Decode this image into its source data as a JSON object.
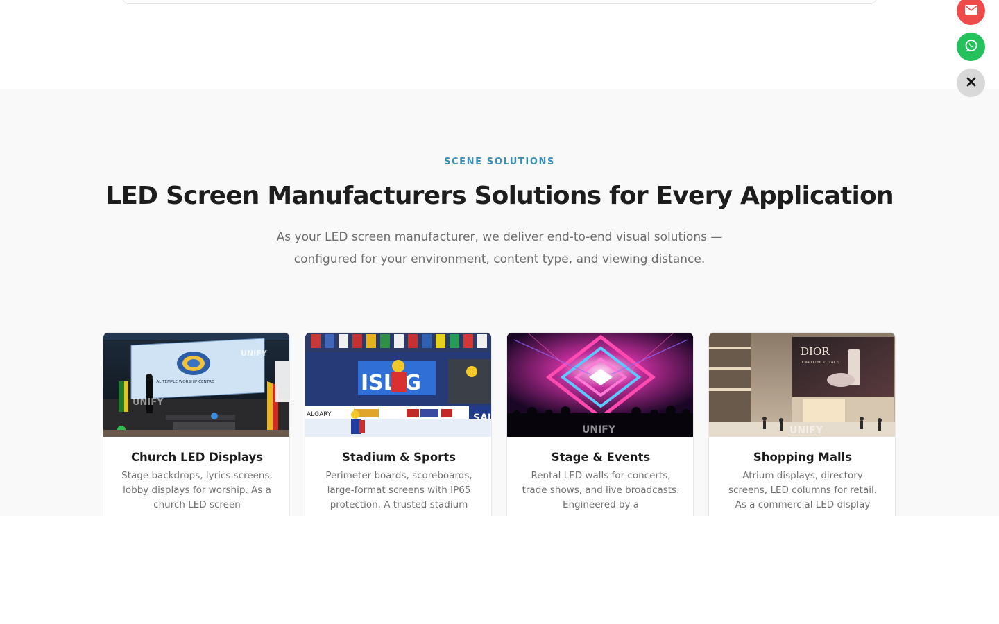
{
  "section": {
    "eyebrow": "SCENE SOLUTIONS",
    "title": "LED Screen Manufacturers Solutions for Every Application",
    "subtitle": "As your LED screen manufacturer, we deliver end-to-end visual solutions — configured for your environment, content type, and viewing distance."
  },
  "cards": [
    {
      "title": "Church LED Displays",
      "description": "Stage backdrops, lyrics screens, lobby displays for worship. As a church LED screen",
      "image_icon": "church-stage-photo",
      "screen_caption": "AL TEMPLE WORSHIP CENTRE",
      "watermark": "UNIFY"
    },
    {
      "title": "Stadium & Sports",
      "description": "Perimeter boards, scoreboards, large-format screens with IP65 protection. A trusted stadium",
      "image_icon": "ice-rink-photo",
      "screen_caption": "ISL G",
      "banner_caption": "ALGARY",
      "side_text": "SAI",
      "watermark": ""
    },
    {
      "title": "Stage & Events",
      "description": "Rental LED walls for concerts, trade shows, and live broadcasts. Engineered by a",
      "image_icon": "concert-stage-photo",
      "watermark": "UNIFY"
    },
    {
      "title": "Shopping Malls",
      "description": "Atrium displays, directory screens, LED columns for retail. As a commercial LED display",
      "image_icon": "mall-atrium-photo",
      "screen_caption": "DIOR",
      "screen_subcaption": "CAPTURE TOTALE",
      "watermark": "UNIFY"
    }
  ],
  "floating_actions": [
    {
      "name": "email",
      "icon": "envelope-icon",
      "color": "#ef4b4b"
    },
    {
      "name": "whatsapp",
      "icon": "whatsapp-icon",
      "color": "#25c15d"
    },
    {
      "name": "close",
      "icon": "close-icon",
      "color": "#d9d9d9"
    }
  ],
  "colors": {
    "accent": "#3a8fb3",
    "section_bg": "#f9f9f9",
    "heading": "#1d1d1d",
    "body_text": "#6c6c6c"
  }
}
